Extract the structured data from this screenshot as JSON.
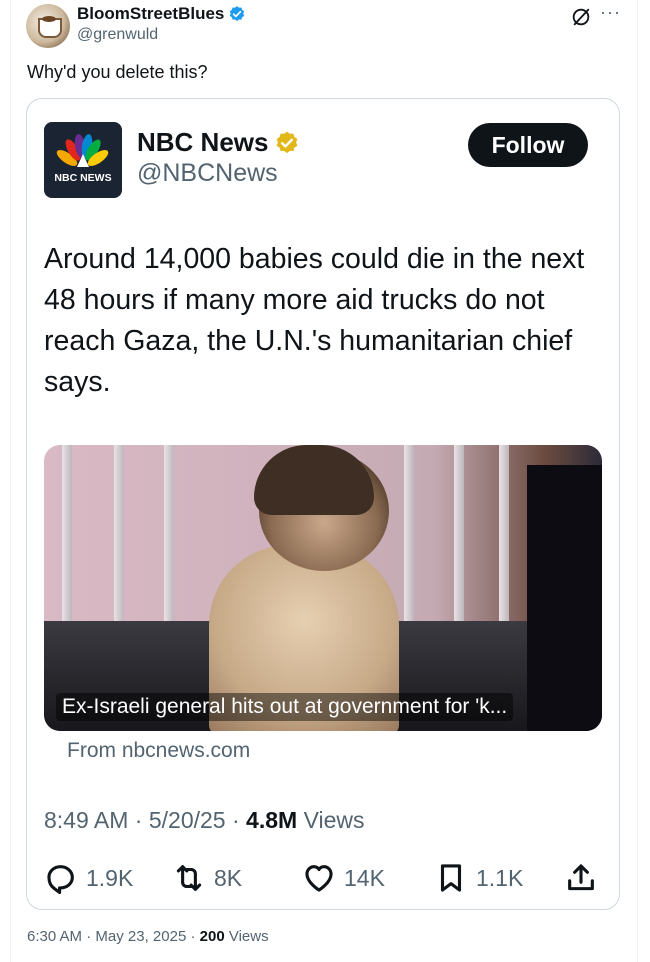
{
  "post": {
    "author_name": "BloomStreetBlues",
    "author_handle": "@grenwuld",
    "text": "Why'd you delete this?",
    "footer": {
      "time": "6:30 AM",
      "sep1": " · ",
      "date": "May 23, 2025",
      "sep2": " · ",
      "views_count": "200",
      "views_label": " Views"
    }
  },
  "quoted": {
    "logo_text": "NBC NEWS",
    "author_name": "NBC News",
    "author_handle": "@NBCNews",
    "follow_label": "Follow",
    "text": "Around 14,000 babies could die in the next 48 hours if many more aid trucks do not reach Gaza, the U.N.'s humanitarian chief says.",
    "link_caption": "Ex-Israeli general hits out at government for 'k...",
    "link_source": "From nbcnews.com",
    "meta": {
      "time": "8:49 AM",
      "sep1": " · ",
      "date": "5/20/25",
      "sep2": " · ",
      "views_count": "4.8M",
      "views_label": " Views"
    },
    "actions": {
      "replies": "1.9K",
      "reposts": "8K",
      "likes": "14K",
      "bookmarks": "1.1K"
    }
  },
  "icons": {
    "verified": "verified-badge-icon",
    "grok": "grok-icon",
    "more": "more-icon",
    "reply": "reply-icon",
    "repost": "repost-icon",
    "like": "heart-icon",
    "bookmark": "bookmark-icon",
    "share": "share-icon"
  },
  "colors": {
    "verified_blue": "#1d9bf0",
    "verified_gold": "#e2b719",
    "text_primary": "#0f1419",
    "text_secondary": "#536471"
  }
}
